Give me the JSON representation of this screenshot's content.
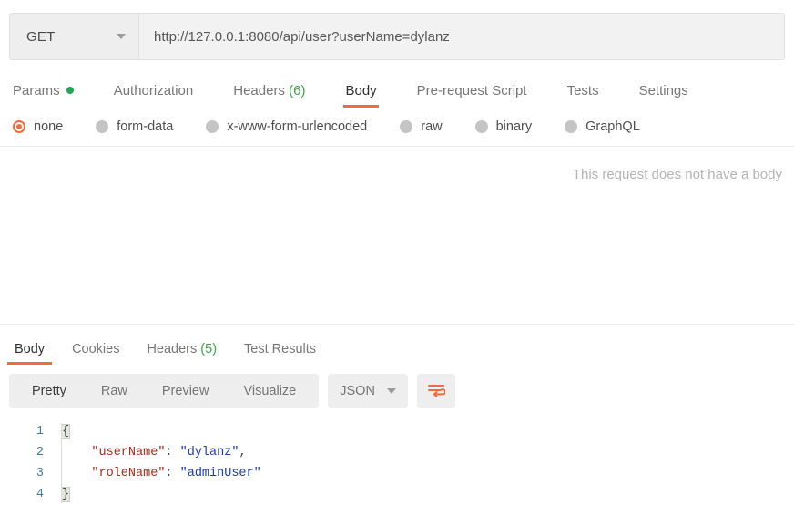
{
  "request": {
    "method": "GET",
    "url": "http://127.0.0.1:8080/api/user?userName=dylanz",
    "tabs": [
      {
        "label": "Params",
        "indicator": "dot",
        "active": false
      },
      {
        "label": "Authorization",
        "indicator": "",
        "active": false
      },
      {
        "label": "Headers",
        "count": "(6)",
        "active": false
      },
      {
        "label": "Body",
        "indicator": "",
        "active": true
      },
      {
        "label": "Pre-request Script",
        "indicator": "",
        "active": false
      },
      {
        "label": "Tests",
        "indicator": "",
        "active": false
      },
      {
        "label": "Settings",
        "indicator": "",
        "active": false
      }
    ],
    "body_types": [
      {
        "label": "none",
        "selected": true
      },
      {
        "label": "form-data",
        "selected": false
      },
      {
        "label": "x-www-form-urlencoded",
        "selected": false
      },
      {
        "label": "raw",
        "selected": false
      },
      {
        "label": "binary",
        "selected": false
      },
      {
        "label": "GraphQL",
        "selected": false
      }
    ],
    "empty_body_message": "This request does not have a body"
  },
  "response": {
    "tabs": [
      {
        "label": "Body",
        "active": true
      },
      {
        "label": "Cookies",
        "active": false
      },
      {
        "label": "Headers",
        "count": "(5)",
        "active": false
      },
      {
        "label": "Test Results",
        "active": false
      }
    ],
    "format_modes": [
      {
        "label": "Pretty",
        "active": true
      },
      {
        "label": "Raw",
        "active": false
      },
      {
        "label": "Preview",
        "active": false
      },
      {
        "label": "Visualize",
        "active": false
      }
    ],
    "language": "JSON",
    "wrap_icon": "word-wrap-icon",
    "code": {
      "line_numbers": [
        "1",
        "2",
        "3",
        "4"
      ],
      "lines": [
        {
          "n": "1",
          "brace": "{",
          "indent": "",
          "key": "",
          "sep": "",
          "value": "",
          "comma": ""
        },
        {
          "n": "2",
          "brace": "",
          "indent": "    ",
          "key": "\"userName\"",
          "sep": ": ",
          "value": "\"dylanz\"",
          "comma": ","
        },
        {
          "n": "3",
          "brace": "",
          "indent": "    ",
          "key": "\"roleName\"",
          "sep": ": ",
          "value": "\"adminUser\"",
          "comma": ""
        },
        {
          "n": "4",
          "brace": "}",
          "indent": "",
          "key": "",
          "sep": "",
          "value": "",
          "comma": ""
        }
      ]
    }
  },
  "colors": {
    "accent_orange": "#ef6c3e",
    "indicator_green": "#1da94f",
    "count_green": "#3fa34a",
    "json_key": "#a52a1e",
    "json_value": "#1b39b8",
    "gutter": "#3d7d9e"
  }
}
